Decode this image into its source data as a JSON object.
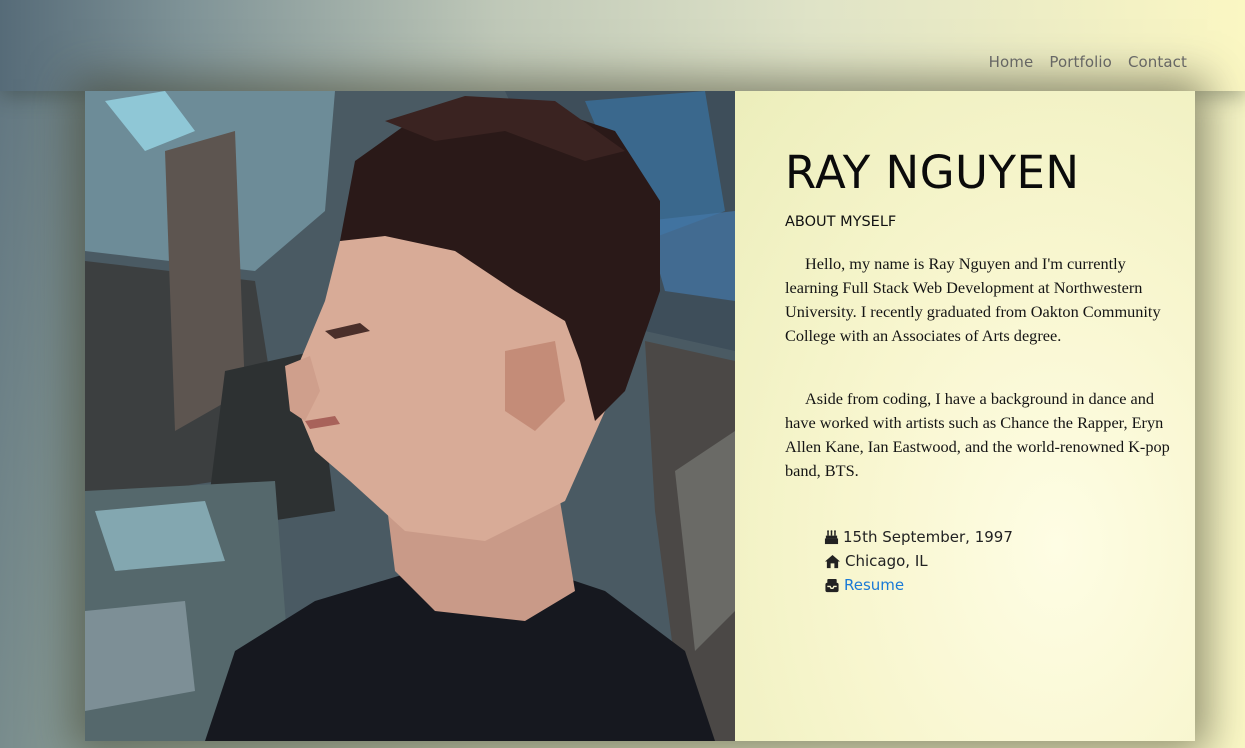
{
  "nav": {
    "links": [
      "Home",
      "Portfolio",
      "Contact"
    ]
  },
  "profile": {
    "name": "RAY NGUYEN",
    "about_heading": "ABOUT MYSELF",
    "paragraphs": [
      "Hello, my name is Ray Nguyen and I'm currently learning Full Stack Web Development at Northwestern University. I recently graduated from Oakton Community College with an Associates of Arts degree.",
      "Aside from coding, I have a background in dance and have worked with artists such as Chance the Rapper, Eryn Allen Kane, Ian Eastwood, and the world-renowned K-pop band, BTS."
    ],
    "birthday": "15th September, 1997",
    "location": "Chicago, IL",
    "resume_label": "Resume"
  },
  "icons": {
    "birthday": "birthday-cake-icon",
    "location": "home-icon",
    "resume": "inbox-icon"
  },
  "colors": {
    "link": "#1a7ad6",
    "panel_background": "#f8f6cf"
  }
}
